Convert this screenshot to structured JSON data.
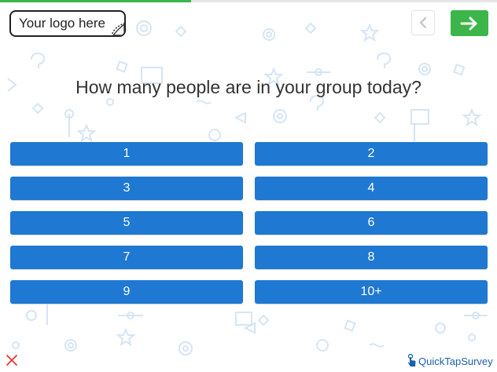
{
  "progress": {
    "fraction": 0.385,
    "color": "#3cb54a"
  },
  "logo": {
    "text": "Your logo here"
  },
  "nav": {
    "back_icon": "chevron-left-icon",
    "next_icon": "arrow-right-icon",
    "next_color": "#3cb54a"
  },
  "question": {
    "text": "How many people are in your group today?"
  },
  "options": [
    "1",
    "2",
    "3",
    "4",
    "5",
    "6",
    "7",
    "8",
    "9",
    "10+"
  ],
  "colors": {
    "option": "#1f78d1",
    "background_icons": "#d8e6f5",
    "close": "#e53935",
    "brand": "#1b5fae"
  },
  "footer": {
    "close_icon": "close-icon",
    "brand_text": "QuickTapSurvey",
    "brand_icon": "tap-hand-icon"
  }
}
